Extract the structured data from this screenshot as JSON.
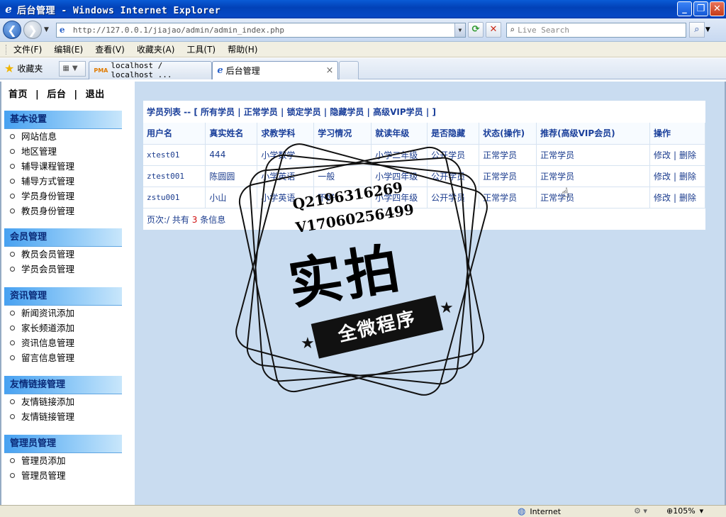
{
  "window": {
    "title": "后台管理 - Windows Internet Explorer",
    "minimize": "_",
    "maximize": "❐",
    "close": "✕"
  },
  "addressbar": {
    "url": "http://127.0.0.1/jiajao/admin/admin_index.php",
    "search_placeholder": "Live Search",
    "back_glyph": "❮",
    "forward_glyph": "❯"
  },
  "menubar": [
    "文件(F)",
    "编辑(E)",
    "查看(V)",
    "收藏夹(A)",
    "工具(T)",
    "帮助(H)"
  ],
  "tabbar": {
    "favorites_label": "收藏夹",
    "tabs": [
      {
        "label": "localhost / localhost ...",
        "icon": "PMA"
      },
      {
        "label": "后台管理",
        "icon": "ie"
      }
    ],
    "close_glyph": "×"
  },
  "leftnav": {
    "top_links": [
      "首页",
      "|",
      "后台",
      "|",
      "退出"
    ],
    "sections": [
      {
        "title": "基本设置",
        "items": [
          "网站信息",
          "地区管理",
          "辅导课程管理",
          "辅导方式管理",
          "学员身份管理",
          "教员身份管理"
        ]
      },
      {
        "title": "会员管理",
        "items": [
          "教员会员管理",
          "学员会员管理"
        ]
      },
      {
        "title": "资讯管理",
        "items": [
          "新闻资讯添加",
          "家长频道添加",
          "资讯信息管理",
          "留言信息管理"
        ]
      },
      {
        "title": "友情链接管理",
        "items": [
          "友情链接添加",
          "友情链接管理"
        ]
      },
      {
        "title": "管理员管理",
        "items": [
          "管理员添加",
          "管理员管理"
        ]
      }
    ]
  },
  "student_list": {
    "title_prefix": "学员列表 -- [",
    "filters": [
      "所有学员",
      "正常学员",
      "锁定学员",
      "隐藏学员",
      "高级VIP学员"
    ],
    "separator": "|",
    "title_suffix": "]",
    "columns": [
      "用户名",
      "真实姓名",
      "求教学科",
      "学习情况",
      "就读年级",
      "是否隐藏",
      "状态(操作)",
      "推荐(高级VIP会员)",
      "操作"
    ],
    "rows": [
      [
        "xtest01",
        "444",
        "小学数学",
        "",
        "小学二年级",
        "公开学员",
        "正常学员",
        "正常学员"
      ],
      [
        "ztest001",
        "陈圆圆",
        "小学英语",
        "一般",
        "小学四年级",
        "公开学员",
        "正常学员",
        "正常学员"
      ],
      [
        "zstu001",
        "小山",
        "小学英语",
        "不好",
        "小学四年级",
        "公开学员",
        "正常学员",
        "正常学员"
      ]
    ],
    "row_actions": {
      "edit": "修改",
      "sep": "|",
      "delete": "删除"
    },
    "pager": {
      "prefix": "页次:/",
      "total_label": "共有",
      "count": "3",
      "suffix": "条信息"
    }
  },
  "stamp": {
    "qq": "Q2196316269",
    "vx": "V17060256499",
    "big": "实拍",
    "ribbon": "全微程序"
  },
  "statusbar": {
    "zone": "Internet",
    "zoom": "105%"
  }
}
